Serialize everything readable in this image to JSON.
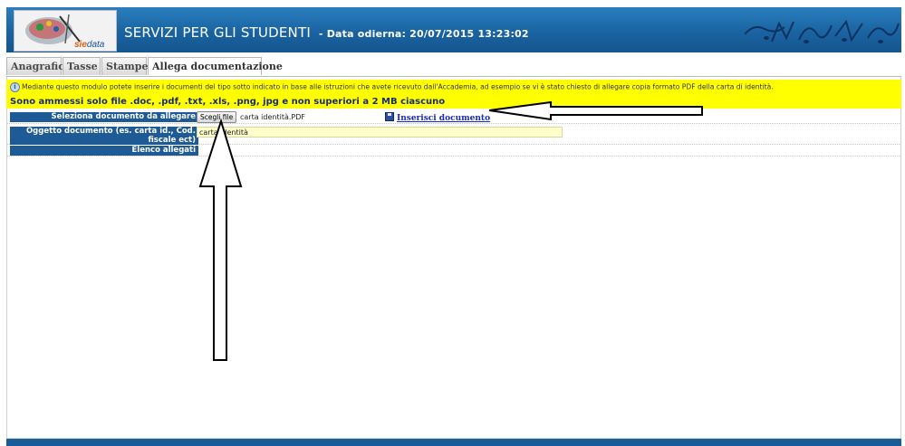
{
  "header": {
    "logo_text": "siedata",
    "app_title": "SERVIZI PER GLI STUDENTI",
    "date_label": "- Data odierna: 20/07/2015 13:23:02"
  },
  "tabs": [
    {
      "label": "Anagrafica",
      "active": false
    },
    {
      "label": "Tasse",
      "active": false
    },
    {
      "label": "Stampe",
      "active": false
    },
    {
      "label": "Allega documentazione",
      "active": true
    }
  ],
  "notice": {
    "line1": "Mediante questo modulo potete inserire i documenti del tipo sotto indicato in base alle istruzioni che avete ricevuto dall'Accademia, ad esempio se vi è stato chiesto di allegare copia formato PDF della carta di identità.",
    "line2": "Sono ammessi solo file .doc, .pdf, .txt, .xls, .png, jpg e non superiori a 2 MB ciascuno"
  },
  "form": {
    "select_label": "Seleziona documento da allegare",
    "choose_button": "Scegli file",
    "chosen_file": "carta identità.PDF",
    "insert_link": "Inserisci documento",
    "subject_label_line1": "Oggetto documento (es. carta id., Cod.",
    "subject_label_line2": "fiscale ect)",
    "subject_value": "carta identità",
    "attachments_label": "Elenco allegati"
  },
  "colors": {
    "banner": "#1a63a1",
    "notice_bg": "#ffff00",
    "label_bg": "#1e5a96",
    "link": "#1a2bc0"
  },
  "icons": [
    "logo-icon",
    "info-icon",
    "save-disk-icon",
    "music-notes-decoration"
  ]
}
